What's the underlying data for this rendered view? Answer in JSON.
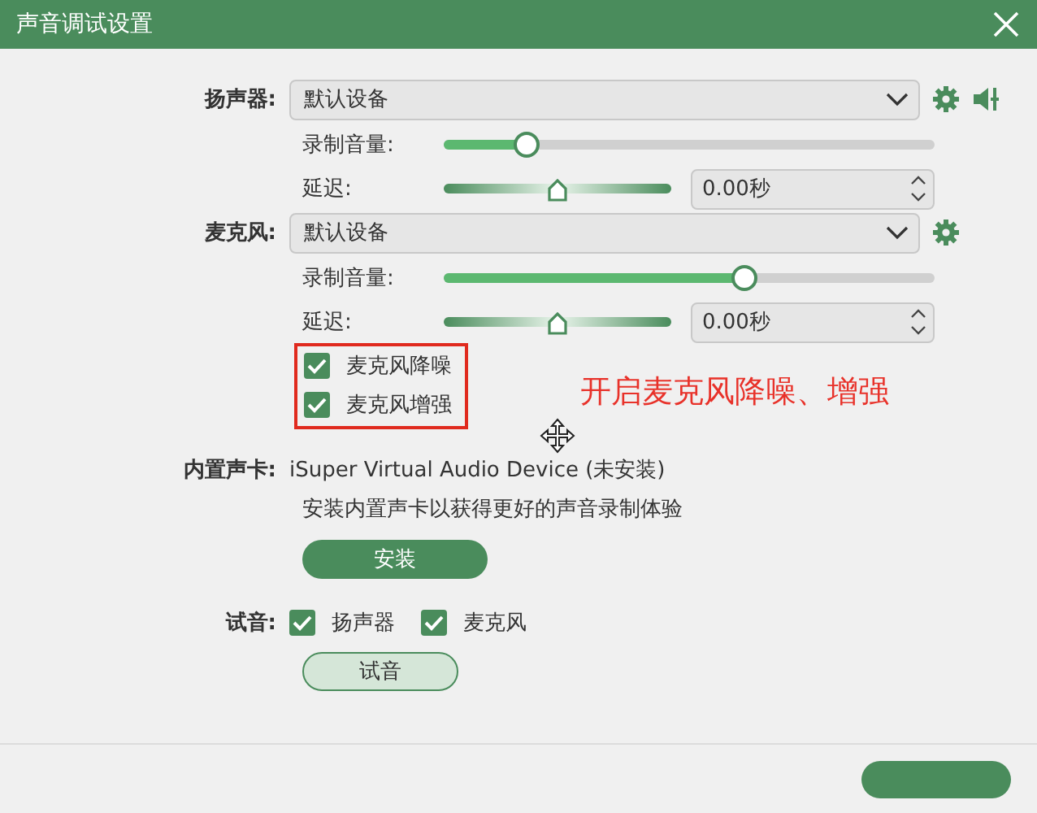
{
  "window": {
    "title": "声音调试设置"
  },
  "speaker": {
    "label": "扬声器:",
    "device": "默认设备",
    "volume": {
      "label": "录制音量:",
      "level": 0.165
    },
    "delay": {
      "label": "延迟:",
      "level": 0.5,
      "value": "0.00秒"
    }
  },
  "microphone": {
    "label": "麦克风:",
    "device": "默认设备",
    "volume": {
      "label": "录制音量:",
      "level": 0.61
    },
    "delay": {
      "label": "延迟:",
      "level": 0.5,
      "value": "0.00秒"
    },
    "options": [
      {
        "label": "麦克风降噪",
        "checked": true
      },
      {
        "label": "麦克风增强",
        "checked": true
      }
    ]
  },
  "annotation": {
    "text": "开启麦克风降噪、增强"
  },
  "sound_card": {
    "label": "内置声卡:",
    "device": "iSuper Virtual Audio Device (未安装)",
    "hint": "安装内置声卡以获得更好的声音录制体验",
    "button": "安装"
  },
  "test": {
    "label": "试音:",
    "options": [
      {
        "label": "扬声器",
        "checked": true
      },
      {
        "label": "麦克风",
        "checked": true
      }
    ],
    "button": "试音"
  },
  "footer": {
    "buttons": [
      {
        "kind": "primary"
      }
    ]
  }
}
